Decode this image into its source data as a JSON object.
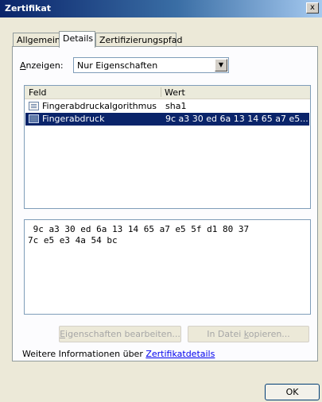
{
  "window": {
    "title": "Zertifikat",
    "close_label": "x"
  },
  "tabs": [
    {
      "label": "Allgemein",
      "active": false
    },
    {
      "label": "Details",
      "active": true
    },
    {
      "label": "Zertifizierungspfad",
      "active": false
    }
  ],
  "show": {
    "label_prefix": "A",
    "label_rest": "nzeigen:",
    "value": "Nur Eigenschaften"
  },
  "list": {
    "columns": [
      "Feld",
      "Wert"
    ],
    "rows": [
      {
        "field": "Fingerabdruckalgorithmus",
        "value": "sha1",
        "selected": false
      },
      {
        "field": "Fingerabdruck",
        "value": "9c a3 30 ed 6a 13 14 65 a7 e5...",
        "selected": true
      }
    ]
  },
  "detail_text": " 9c a3 30 ed 6a 13 14 65 a7 e5 5f d1 80 37\n7c e5 e3 4a 54 bc",
  "buttons": {
    "edit_properties": {
      "prefix": "E",
      "rest": "igenschaften bearbeiten..."
    },
    "copy_to_file": {
      "before": "In Datei ",
      "underlined": "k",
      "after": "opieren..."
    }
  },
  "more_info": {
    "text": "Weitere Informationen über ",
    "link": "Zertifikatdetails"
  },
  "ok_label": "OK",
  "colors": {
    "selection": "#0a246a",
    "titlebar_start": "#0a246a",
    "link": "#0000ee"
  }
}
